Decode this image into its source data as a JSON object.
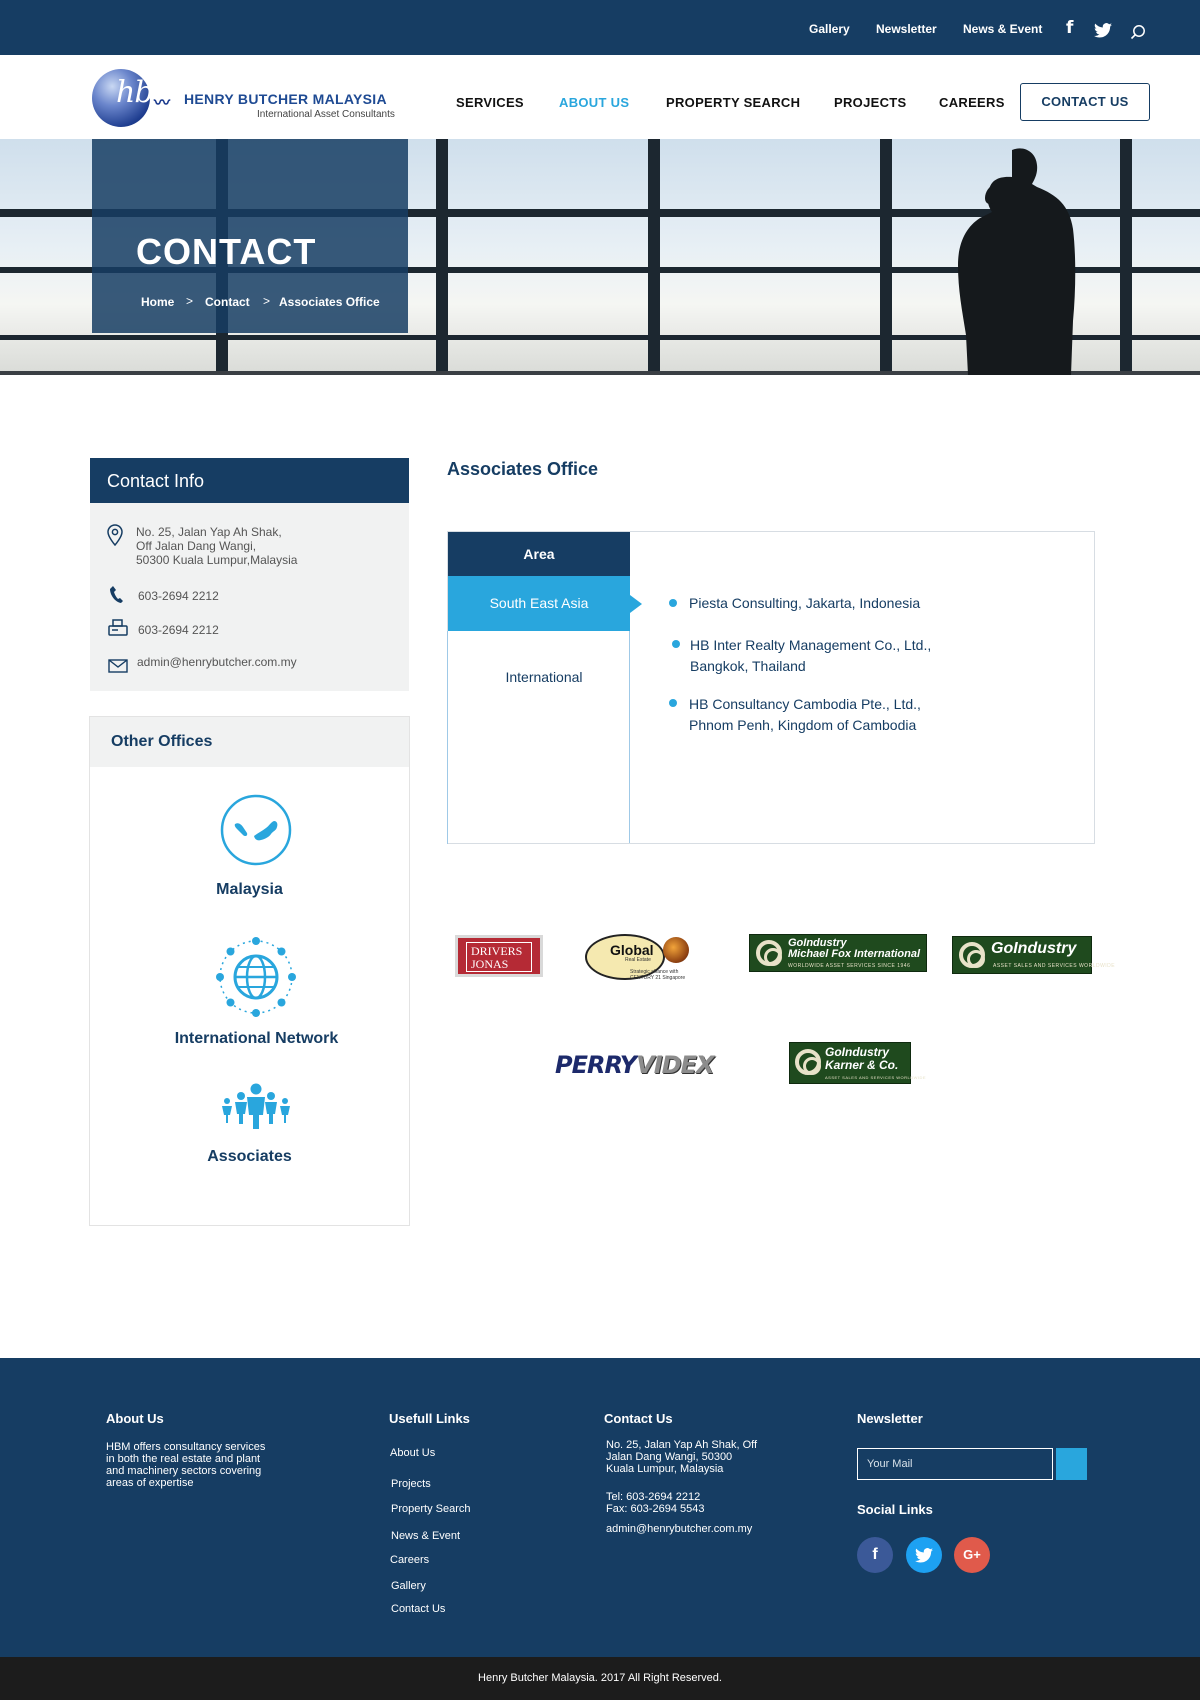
{
  "topbar": {
    "links": [
      "Gallery",
      "Newsletter",
      "News & Event"
    ],
    "icons": [
      "facebook-icon",
      "twitter-icon",
      "search-icon"
    ]
  },
  "logo": {
    "mark": "hb",
    "name": "HENRY BUTCHER MALAYSIA",
    "tagline": "International Asset Consultants"
  },
  "nav": {
    "items": [
      "SERVICES",
      "ABOUT US",
      "PROPERTY SEARCH",
      "PROJECTS",
      "CAREERS"
    ],
    "active": "ABOUT US",
    "cta": "CONTACT US"
  },
  "hero": {
    "title": "CONTACT",
    "breadcrumb": [
      "Home",
      "Contact",
      "Associates Office"
    ]
  },
  "contact_info": {
    "title": "Contact Info",
    "address": [
      "No. 25, Jalan Yap Ah Shak,",
      "Off Jalan Dang Wangi,",
      "50300 Kuala Lumpur,Malaysia"
    ],
    "phone": "603-2694 2212",
    "fax": "603-2694 2212",
    "email": "admin@henrybutcher.com.my"
  },
  "other_offices": {
    "title": "Other Offices",
    "items": [
      "Malaysia",
      "International Network",
      "Associates"
    ]
  },
  "main": {
    "title": "Associates Office",
    "tab_header": "Area",
    "tabs": [
      "South East Asia",
      "International"
    ],
    "active_tab": "South East Asia",
    "offices": [
      [
        "Piesta Consulting, Jakarta, Indonesia"
      ],
      [
        "HB Inter Realty Management Co., Ltd.,",
        "Bangkok, Thailand"
      ],
      [
        "HB Consultancy Cambodia Pte., Ltd.,",
        "Phnom Penh, Kingdom of Cambodia"
      ]
    ]
  },
  "partners": {
    "drivers_jonas": [
      "DRIVERS",
      "JONAS"
    ],
    "global": {
      "name": "Global",
      "sub1": "Real Estate",
      "sub2": "Strategic alliance with",
      "sub3": "CENTURY 21 Singapore"
    },
    "gi_mfi": {
      "line1": "GoIndustry",
      "line2": "Michael Fox International",
      "sub": "WORLDWIDE ASSET SERVICES SINCE 1946"
    },
    "gi": {
      "name": "GoIndustry",
      "sub": "ASSET SALES AND SERVICES WORLDWIDE"
    },
    "perry": [
      "PERRY",
      "VIDEX"
    ],
    "gi_karner": {
      "line1": "GoIndustry",
      "line2": "Karner & Co.",
      "sub": "ASSET SALES AND SERVICES WORLDWIDE"
    }
  },
  "footer": {
    "about": {
      "title": "About Us",
      "text": [
        "HBM offers consultancy services",
        "in both the real estate and plant",
        "and machinery sectors covering",
        "areas of expertise"
      ]
    },
    "links": {
      "title": "Usefull Links",
      "items": [
        "About Us",
        "Projects",
        "Property Search",
        "News & Event",
        "Careers",
        "Gallery",
        "Contact Us"
      ]
    },
    "contact": {
      "title": "Contact Us",
      "address": [
        "No. 25, Jalan Yap Ah Shak, Off",
        "Jalan Dang Wangi, 50300",
        "Kuala Lumpur, Malaysia"
      ],
      "tel": "Tel: 603-2694 2212",
      "fax": "Fax: 603-2694 5543",
      "email": "admin@henrybutcher.com.my"
    },
    "newsletter": {
      "title": "Newsletter",
      "placeholder": "Your Mail"
    },
    "social": {
      "title": "Social Links",
      "items": [
        {
          "icon": "facebook-icon",
          "glyph": "f",
          "color": "#3b5998"
        },
        {
          "icon": "twitter-icon",
          "glyph": "t",
          "color": "#1da1f2"
        },
        {
          "icon": "google-plus-icon",
          "glyph": "G+",
          "color": "#e05a4b"
        }
      ]
    },
    "copyright": "Henry Butcher Malaysia. 2017 All Right Reserved."
  },
  "colors": {
    "navy": "#163d63",
    "accent": "#29a6dd",
    "panel": "#f1f2f2",
    "copyright_bar": "#1c1c1c"
  }
}
